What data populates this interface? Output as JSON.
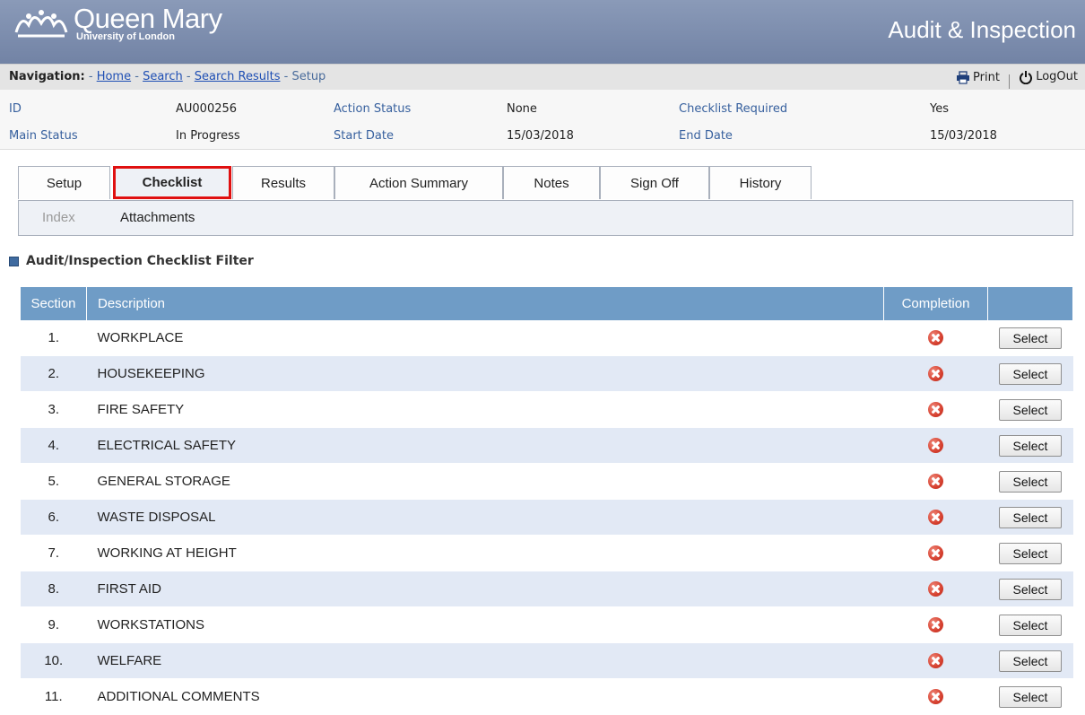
{
  "header": {
    "logo_name": "Queen Mary",
    "logo_subtitle": "University of London",
    "app_title": "Audit & Inspection"
  },
  "nav": {
    "label": "Navigation:",
    "separator": "-",
    "links": [
      "Home",
      "Search",
      "Search Results"
    ],
    "current": "Setup",
    "print_label": "Print",
    "logout_label": "LogOut"
  },
  "info": {
    "id_label": "ID",
    "id_value": "AU000256",
    "action_status_label": "Action Status",
    "action_status_value": "None",
    "checklist_required_label": "Checklist Required",
    "checklist_required_value": "Yes",
    "main_status_label": "Main Status",
    "main_status_value": "In Progress",
    "start_date_label": "Start Date",
    "start_date_value": "15/03/2018",
    "end_date_label": "End Date",
    "end_date_value": "15/03/2018"
  },
  "tabs": [
    "Setup",
    "Checklist",
    "Results",
    "Action Summary",
    "Notes",
    "Sign Off",
    "History"
  ],
  "active_tab": "Checklist",
  "subtabs": {
    "index": "Index",
    "attachments": "Attachments"
  },
  "section_title": "Audit/Inspection Checklist Filter",
  "table": {
    "headers": {
      "section": "Section",
      "description": "Description",
      "completion": "Completion"
    },
    "select_label": "Select",
    "rows": [
      {
        "section": "1.",
        "description": "WORKPLACE",
        "completion": "incomplete"
      },
      {
        "section": "2.",
        "description": "HOUSEKEEPING",
        "completion": "incomplete"
      },
      {
        "section": "3.",
        "description": "FIRE SAFETY",
        "completion": "incomplete"
      },
      {
        "section": "4.",
        "description": "ELECTRICAL SAFETY",
        "completion": "incomplete"
      },
      {
        "section": "5.",
        "description": "GENERAL STORAGE",
        "completion": "incomplete"
      },
      {
        "section": "6.",
        "description": "WASTE DISPOSAL",
        "completion": "incomplete"
      },
      {
        "section": "7.",
        "description": "WORKING AT HEIGHT",
        "completion": "incomplete"
      },
      {
        "section": "8.",
        "description": "FIRST AID",
        "completion": "incomplete"
      },
      {
        "section": "9.",
        "description": "WORKSTATIONS",
        "completion": "incomplete"
      },
      {
        "section": "10.",
        "description": "WELFARE",
        "completion": "incomplete"
      },
      {
        "section": "11.",
        "description": "ADDITIONAL COMMENTS",
        "completion": "incomplete"
      }
    ]
  },
  "colors": {
    "banner": "#7b8bac",
    "table_header": "#6f9cc6",
    "row_alt": "#e2e9f5",
    "active_tab_highlight": "#e01010",
    "link": "#1f4fb4"
  },
  "icons": {
    "incomplete": "red-x-circle-icon",
    "print": "printer-icon",
    "logout": "power-icon"
  }
}
